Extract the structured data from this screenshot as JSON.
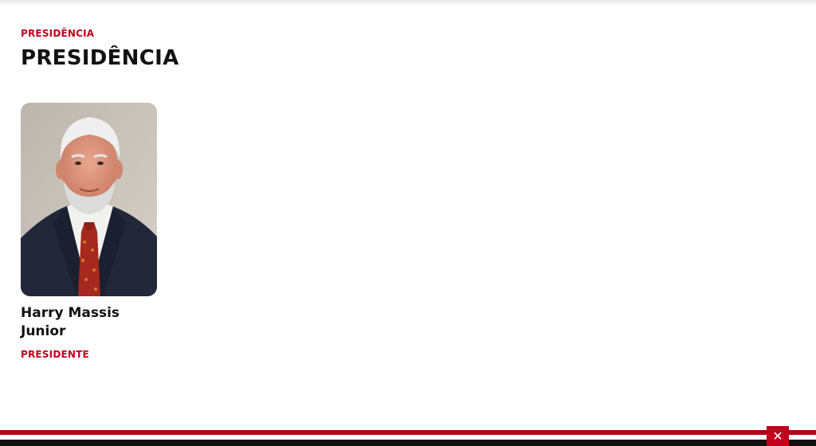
{
  "header": {
    "breadcrumb": "PRESIDÊNCIA",
    "title": "PRESIDÊNCIA"
  },
  "members": [
    {
      "name": "Harry Massis Junior",
      "role": "PRESIDENTE"
    }
  ],
  "footer": {
    "close_icon": "close-icon",
    "close_glyph": "✕"
  },
  "colors": {
    "accent": "#c0001c",
    "text": "#111111",
    "footer_red": "#b30019",
    "footer_black": "#111111"
  }
}
